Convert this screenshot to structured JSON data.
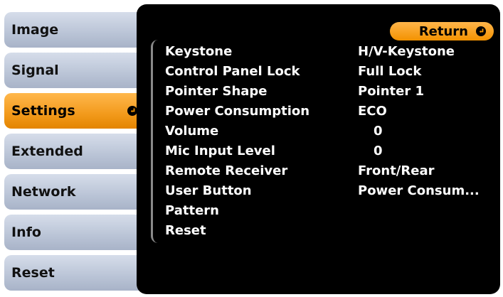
{
  "menu": {
    "tabs": [
      {
        "label": "Image"
      },
      {
        "label": "Signal"
      },
      {
        "label": "Settings",
        "active": true
      },
      {
        "label": "Extended"
      },
      {
        "label": "Network"
      },
      {
        "label": "Info"
      },
      {
        "label": "Reset"
      }
    ]
  },
  "panel": {
    "return_label": "Return",
    "rows": [
      {
        "label": "Keystone",
        "value": "H/V-Keystone"
      },
      {
        "label": "Control Panel Lock",
        "value": "Full Lock"
      },
      {
        "label": "Pointer Shape",
        "value": "Pointer 1"
      },
      {
        "label": "Power Consumption",
        "value": "ECO"
      },
      {
        "label": "Volume",
        "value": "0"
      },
      {
        "label": "Mic Input Level",
        "value": "0"
      },
      {
        "label": "Remote Receiver",
        "value": "Front/Rear"
      },
      {
        "label": "User Button",
        "value": "Power Consum..."
      },
      {
        "label": "Pattern",
        "value": ""
      },
      {
        "label": "Reset",
        "value": ""
      }
    ]
  },
  "colors": {
    "accent": "#f39200",
    "tab": "#bcc6d8",
    "panel": "#000000",
    "text": "#ffffff"
  },
  "icons": {
    "enter": "enter-icon"
  }
}
